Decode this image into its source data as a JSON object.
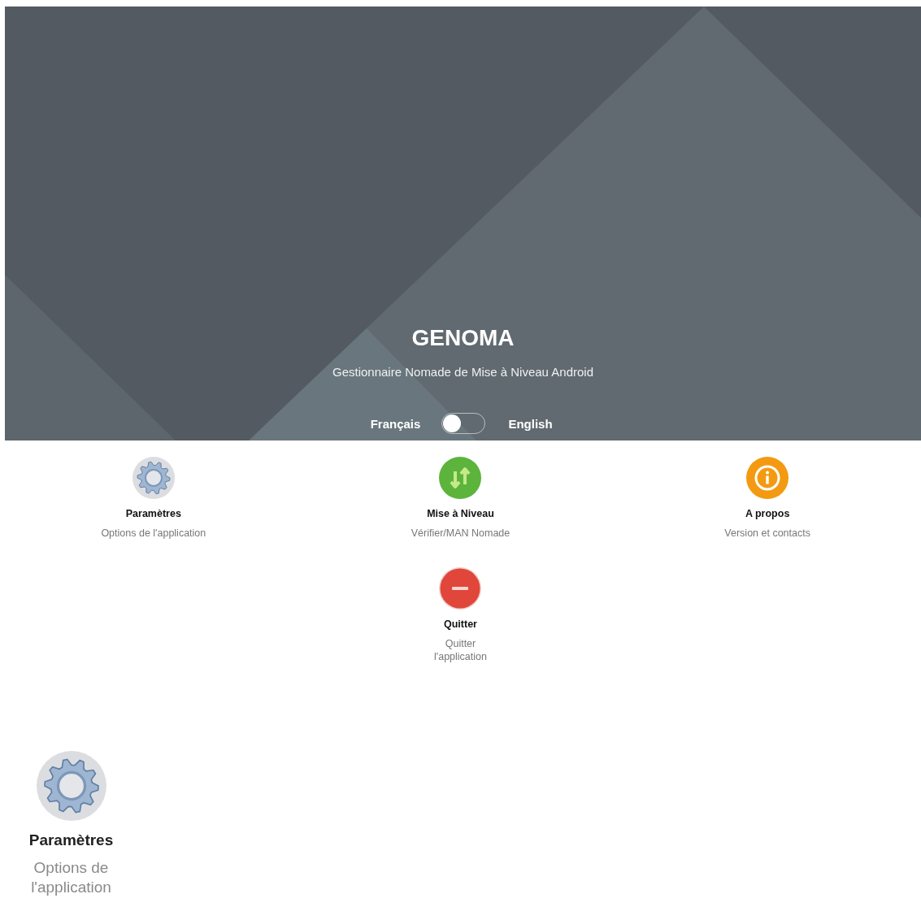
{
  "header": {
    "title": "GENOMA",
    "subtitle": "Gestionnaire Nomade de Mise à Niveau Android",
    "language_toggle": {
      "left_label": "Français",
      "right_label": "English",
      "on": false
    }
  },
  "menu_items": [
    {
      "kind": "gear",
      "title": "Paramètres",
      "subtitle": "Options de l'application"
    },
    {
      "kind": "update",
      "title": "Mise à Niveau",
      "subtitle": "Vérifier/MAN Nomade"
    },
    {
      "kind": "info",
      "title": "A propos",
      "subtitle": "Version et contacts"
    },
    {
      "kind": "exit",
      "title": "Quitter",
      "subtitle": "Quitter l'application"
    }
  ],
  "enlarged_item": {
    "kind": "gear",
    "title": "Paramètres",
    "subtitle": "Options de l'application"
  }
}
